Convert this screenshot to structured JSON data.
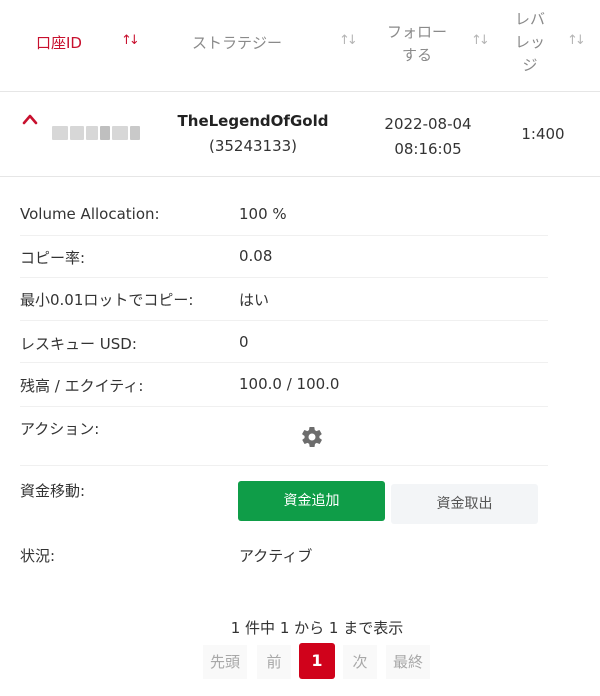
{
  "table": {
    "headers": {
      "account_id": "口座ID",
      "strategy": "ストラテジー",
      "follow_line1": "フォロー",
      "follow_line2": "する",
      "leverage_line1": "レバ",
      "leverage_line2": "レッ",
      "leverage_line3": "ジ"
    },
    "sort_icon": "⇅",
    "row": {
      "strategy_name": "TheLegendOfGold",
      "strategy_id": "(35243133)",
      "follow_date": "2022-08-04",
      "follow_time": "08:16:05",
      "leverage": "1:400"
    }
  },
  "details": {
    "volume_allocation_label": "Volume Allocation:",
    "volume_allocation_value": "100 %",
    "copy_ratio_label": "コピー率:",
    "copy_ratio_value": "0.08",
    "min_lot_label": "最小0.01ロットでコピー:",
    "min_lot_value": "はい",
    "rescue_label": "レスキュー USD:",
    "rescue_value": "0",
    "balance_equity_label": "残高 / エクイティ:",
    "balance_equity_value": "100.0 / 100.0",
    "action_label": "アクション:",
    "funds_label": "資金移動:",
    "add_funds": "資金追加",
    "withdraw_funds": "資金取出",
    "status_label": "状況:",
    "status_value": "アクティブ"
  },
  "pagination": {
    "summary": "1 件中 1 から 1 まで表示",
    "first": "先頭",
    "prev": "前",
    "current": "1",
    "next": "次",
    "last": "最終"
  },
  "colors": {
    "accent_red": "#c8102e",
    "primary_green": "#0f9d48",
    "page_red": "#d0021b"
  },
  "icons": [
    "sort-icon",
    "chevron-up-icon",
    "gear-icon"
  ]
}
